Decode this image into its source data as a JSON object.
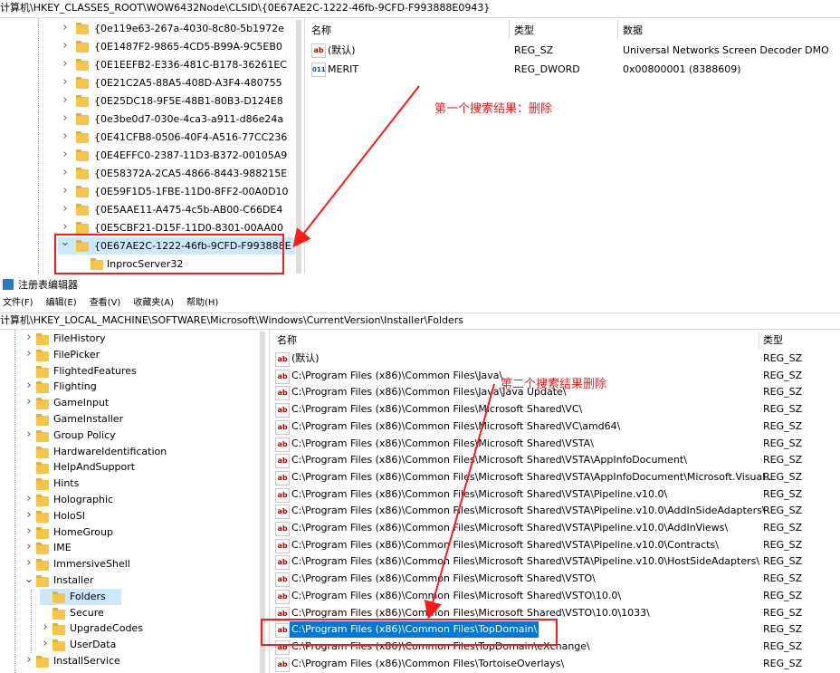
{
  "top": {
    "path": "计算机\\HKEY_CLASSES_ROOT\\WOW6432Node\\CLSID\\{0E67AE2C-1222-46fb-9CFD-F993888E0943}",
    "tree": [
      "{0e119e63-267a-4030-8c80-5b1972e",
      "{0E1487F2-9865-4CD5-B99A-9C5EB0",
      "{0E1EEFB2-E336-481C-B178-36261EC",
      "{0E21C2A5-88A5-408D-A3F4-480755",
      "{0E25DC18-9F5E-48B1-80B3-D124E8",
      "{0e3be0d7-030e-4ca3-a911-d86e24a",
      "{0E41CFB8-0506-40F4-A516-77CC236",
      "{0E4EFFC0-2387-11D3-B372-00105A9",
      "{0E58372A-2CA5-4866-8443-988215E",
      "{0E59F1D5-1FBE-11D0-8FF2-00A0D10",
      "{0E5AAE11-A475-4c5b-AB00-C66DE4",
      "{0E5CBF21-D15F-11D0-8301-00AA00"
    ],
    "selected_key": "{0E67AE2C-1222-46fb-9CFD-F993888E",
    "child_key": "InprocServer32",
    "columns": {
      "name": "名称",
      "type": "类型",
      "data": "数据"
    },
    "values": [
      {
        "name": "(默认)",
        "type": "REG_SZ",
        "data": "Universal Networks Screen Decoder DMO",
        "icon": "ab"
      },
      {
        "name": "MERIT",
        "type": "REG_DWORD",
        "data": "0x00800001 (8388609)",
        "icon": "bin"
      }
    ],
    "annotation": "第一个搜索结果：删除"
  },
  "app": {
    "title": "注册表编辑器",
    "menu": [
      "文件(F)",
      "编辑(E)",
      "查看(V)",
      "收藏夹(A)",
      "帮助(H)"
    ]
  },
  "bottom": {
    "path": "计算机\\HKEY_LOCAL_MACHINE\\SOFTWARE\\Microsoft\\Windows\\CurrentVersion\\Installer\\Folders",
    "tree": [
      {
        "label": "FileHistory",
        "level": 0,
        "exp": ">"
      },
      {
        "label": "FilePicker",
        "level": 0,
        "exp": ">"
      },
      {
        "label": "FlightedFeatures",
        "level": 0,
        "exp": ""
      },
      {
        "label": "Flighting",
        "level": 0,
        "exp": ">"
      },
      {
        "label": "GameInput",
        "level": 0,
        "exp": ">"
      },
      {
        "label": "GameInstaller",
        "level": 0,
        "exp": ""
      },
      {
        "label": "Group Policy",
        "level": 0,
        "exp": ">"
      },
      {
        "label": "HardwareIdentification",
        "level": 0,
        "exp": ""
      },
      {
        "label": "HelpAndSupport",
        "level": 0,
        "exp": ""
      },
      {
        "label": "Hints",
        "level": 0,
        "exp": ""
      },
      {
        "label": "Holographic",
        "level": 0,
        "exp": ">"
      },
      {
        "label": "HoloSI",
        "level": 0,
        "exp": ">"
      },
      {
        "label": "HomeGroup",
        "level": 0,
        "exp": ">"
      },
      {
        "label": "IME",
        "level": 0,
        "exp": ">"
      },
      {
        "label": "ImmersiveShell",
        "level": 0,
        "exp": ">"
      },
      {
        "label": "Installer",
        "level": 0,
        "exp": "v"
      },
      {
        "label": "Folders",
        "level": 1,
        "exp": "",
        "selected": true
      },
      {
        "label": "Secure",
        "level": 1,
        "exp": ""
      },
      {
        "label": "UpgradeCodes",
        "level": 1,
        "exp": ">"
      },
      {
        "label": "UserData",
        "level": 1,
        "exp": ">"
      },
      {
        "label": "InstallService",
        "level": 0,
        "exp": ">"
      }
    ],
    "columns": {
      "name": "名称",
      "type": "类型"
    },
    "values": [
      {
        "name": "(默认)",
        "type": "REG_SZ"
      },
      {
        "name": "C:\\Program Files (x86)\\Common Files\\Java\\",
        "type": "REG_SZ"
      },
      {
        "name": "C:\\Program Files (x86)\\Common Files\\Java\\Java Update\\",
        "type": "REG_SZ"
      },
      {
        "name": "C:\\Program Files (x86)\\Common Files\\Microsoft Shared\\VC\\",
        "type": "REG_SZ"
      },
      {
        "name": "C:\\Program Files (x86)\\Common Files\\Microsoft Shared\\VC\\amd64\\",
        "type": "REG_SZ"
      },
      {
        "name": "C:\\Program Files (x86)\\Common Files\\Microsoft Shared\\VSTA\\",
        "type": "REG_SZ"
      },
      {
        "name": "C:\\Program Files (x86)\\Common Files\\Microsoft Shared\\VSTA\\AppInfoDocument\\",
        "type": "REG_SZ"
      },
      {
        "name": "C:\\Program Files (x86)\\Common Files\\Microsoft Shared\\VSTA\\AppInfoDocument\\Microsoft.Visual...",
        "type": "REG_SZ"
      },
      {
        "name": "C:\\Program Files (x86)\\Common Files\\Microsoft Shared\\VSTA\\Pipeline.v10.0\\",
        "type": "REG_SZ"
      },
      {
        "name": "C:\\Program Files (x86)\\Common Files\\Microsoft Shared\\VSTA\\Pipeline.v10.0\\AddInSideAdapters\\",
        "type": "REG_SZ"
      },
      {
        "name": "C:\\Program Files (x86)\\Common Files\\Microsoft Shared\\VSTA\\Pipeline.v10.0\\AddInViews\\",
        "type": "REG_SZ"
      },
      {
        "name": "C:\\Program Files (x86)\\Common Files\\Microsoft Shared\\VSTA\\Pipeline.v10.0\\Contracts\\",
        "type": "REG_SZ"
      },
      {
        "name": "C:\\Program Files (x86)\\Common Files\\Microsoft Shared\\VSTA\\Pipeline.v10.0\\HostSideAdapters\\",
        "type": "REG_SZ"
      },
      {
        "name": "C:\\Program Files (x86)\\Common Files\\Microsoft Shared\\VSTO\\",
        "type": "REG_SZ"
      },
      {
        "name": "C:\\Program Files (x86)\\Common Files\\Microsoft Shared\\VSTO\\10.0\\",
        "type": "REG_SZ"
      },
      {
        "name": "C:\\Program Files (x86)\\Common Files\\Microsoft Shared\\VSTO\\10.0\\1033\\",
        "type": "REG_SZ"
      },
      {
        "name": "C:\\Program Files (x86)\\Common Files\\TopDomain\\",
        "type": "REG_SZ",
        "selected": true
      },
      {
        "name": "C:\\Program Files (x86)\\Common Files\\TopDomain\\eXchange\\",
        "type": "REG_SZ"
      },
      {
        "name": "C:\\Program Files (x86)\\Common Files\\TortoiseOverlays\\",
        "type": "REG_SZ"
      }
    ],
    "annotation": "第二个搜索结果删除"
  },
  "colors": {
    "annotation": "#ff1a1a",
    "selection": "#0078d7",
    "tree_selection": "#cce8ff"
  }
}
